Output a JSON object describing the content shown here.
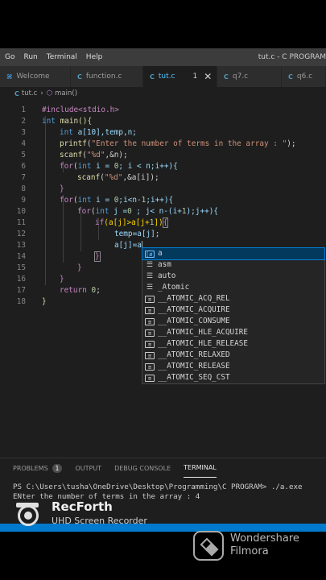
{
  "menu": {
    "items": [
      "Go",
      "Run",
      "Terminal",
      "Help"
    ],
    "window_title": "tut.c - C PROGRAM"
  },
  "tabs": [
    {
      "label": "Welcome"
    },
    {
      "label": "function.c"
    },
    {
      "label": "tut.c",
      "badge": "1"
    },
    {
      "label": "q7.c"
    },
    {
      "label": "q6.c"
    }
  ],
  "breadcrumb": {
    "file": "tut.c",
    "symbol": "main()"
  },
  "editor": {
    "line_numbers": [
      "1",
      "2",
      "3",
      "4",
      "5",
      "6",
      "7",
      "8",
      "9",
      "10",
      "11",
      "12",
      "13",
      "14",
      "15",
      "16",
      "17",
      "18"
    ],
    "lines": {
      "l1": "#include<stdio.h>",
      "l2a": "int",
      "l2b": " main(){",
      "l3a": "int",
      "l3b": " a[10],temp,n;",
      "l4a": "printf",
      "l4b": "(",
      "l4c": "\"Enter the number of terms in the array : \"",
      "l4d": ");",
      "l5a": "scanf",
      "l5b": "(",
      "l5c": "\"%d\"",
      "l5d": ",&n);",
      "l6a": "for",
      "l6b": "(",
      "l6c": "int",
      "l6d": " i = ",
      "l6e": "0",
      "l6f": "; i < n;i++){",
      "l7a": "scanf",
      "l7b": "(",
      "l7c": "\"%d\"",
      "l7d": ",&a[i]);",
      "l8": "}",
      "l9a": "for",
      "l9b": "(",
      "l9c": "int",
      "l9d": " i = ",
      "l9e": "0",
      "l9f": ";i<n-",
      "l9g": "1",
      "l9h": ";i++){",
      "l10a": "for",
      "l10b": "(",
      "l10c": "int",
      "l10d": " j =",
      "l10e": "0",
      "l10f": " ; j< n-(i+",
      "l10g": "1",
      "l10h": ");j++){",
      "l11a": "if",
      "l11b": "(a[j]>a[j+",
      "l11c": "1",
      "l11d": "])",
      "l11e": "{",
      "l12": "temp=a[j];",
      "l13": "a[j]=a",
      "l14": "}",
      "l15": "}",
      "l16": "}",
      "l17a": "return",
      "l17b": " ",
      "l17c": "0",
      "l17d": ";",
      "l18": "}"
    }
  },
  "suggestions": [
    {
      "label": "a",
      "icon": "variable-icon",
      "selected": true
    },
    {
      "label": "asm",
      "icon": "keyword-icon"
    },
    {
      "label": "auto",
      "icon": "keyword-icon"
    },
    {
      "label": "_Atomic",
      "icon": "keyword-icon"
    },
    {
      "label": "__ATOMIC_ACQ_REL",
      "icon": "constant-icon"
    },
    {
      "label": "__ATOMIC_ACQUIRE",
      "icon": "constant-icon"
    },
    {
      "label": "__ATOMIC_CONSUME",
      "icon": "constant-icon"
    },
    {
      "label": "__ATOMIC_HLE_ACQUIRE",
      "icon": "constant-icon"
    },
    {
      "label": "__ATOMIC_HLE_RELEASE",
      "icon": "constant-icon"
    },
    {
      "label": "__ATOMIC_RELAXED",
      "icon": "constant-icon"
    },
    {
      "label": "__ATOMIC_RELEASE",
      "icon": "constant-icon"
    },
    {
      "label": "__ATOMIC_SEQ_CST",
      "icon": "constant-icon"
    }
  ],
  "panel": {
    "tabs": {
      "problems": "PROBLEMS",
      "problems_count": "1",
      "output": "OUTPUT",
      "debug": "DEBUG CONSOLE",
      "terminal": "TERMINAL"
    },
    "terminal_lines": [
      "PS C:\\Users\\tusha\\OneDrive\\Desktop\\Programming\\C PROGRAM> ./a.exe",
      "ENter the number of terms in the array : 4"
    ]
  },
  "overlay": {
    "recorder_title": "RecForth",
    "recorder_sub": "UHD Screen Recorder",
    "watermark_line1": "Wondershare",
    "watermark_line2": "Filmora"
  },
  "colors": {
    "accent": "#007acc",
    "keyword": "#569cd6",
    "string": "#ce9178",
    "function": "#dcdcaa",
    "number": "#b5cea8",
    "control": "#c586c0"
  }
}
